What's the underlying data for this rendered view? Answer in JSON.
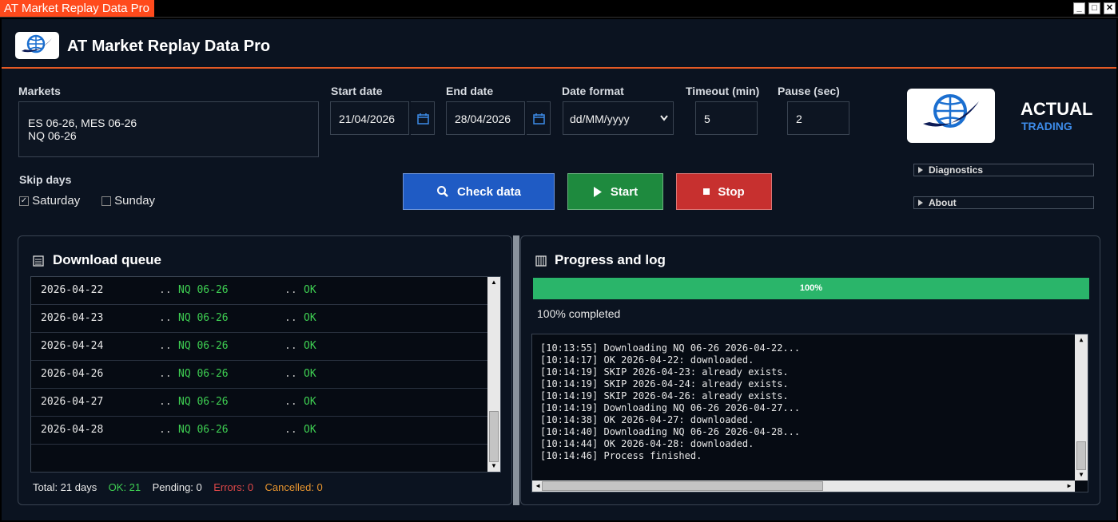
{
  "window": {
    "title": "AT Market Replay Data Pro",
    "controls": [
      "_",
      "□",
      "✕"
    ]
  },
  "header": {
    "title": "AT Market Replay Data Pro"
  },
  "form": {
    "markets_label": "Markets",
    "markets_value_line1": "ES 06-26, MES 06-26",
    "markets_value_line2": "NQ 06-26",
    "start_label": "Start date",
    "start_value": "21/04/2026",
    "end_label": "End date",
    "end_value": "28/04/2026",
    "format_label": "Date format",
    "format_value": "dd/MM/yyyy",
    "timeout_label": "Timeout (min)",
    "timeout_value": "5",
    "pause_label": "Pause (sec)",
    "pause_value": "2",
    "skip_label": "Skip days",
    "saturday_label": "Saturday",
    "saturday_checked": true,
    "sunday_label": "Sunday",
    "sunday_checked": false
  },
  "buttons": {
    "check": "Check data",
    "start": "Start",
    "stop": "Stop"
  },
  "colors": {
    "check": "#1f5bc4",
    "start": "#1e8a3e",
    "stop": "#c7302f",
    "accent": "#e55a25",
    "ok": "#3ecf52",
    "error": "#e04848",
    "cancel": "#e8952e",
    "progress": "#2ab56a"
  },
  "brand": {
    "line1": "ACTUAL",
    "line2": "TRADING"
  },
  "side": {
    "diagnostics": "Diagnostics",
    "about": "About"
  },
  "queue": {
    "title": "Download queue",
    "separator": "..",
    "rows": [
      {
        "date": "2026-04-22",
        "market": "NQ 06-26",
        "status": "OK"
      },
      {
        "date": "2026-04-23",
        "market": "NQ 06-26",
        "status": "OK"
      },
      {
        "date": "2026-04-24",
        "market": "NQ 06-26",
        "status": "OK"
      },
      {
        "date": "2026-04-26",
        "market": "NQ 06-26",
        "status": "OK"
      },
      {
        "date": "2026-04-27",
        "market": "NQ 06-26",
        "status": "OK"
      },
      {
        "date": "2026-04-28",
        "market": "NQ 06-26",
        "status": "OK"
      }
    ],
    "total": "Total: 21 days",
    "ok": "OK: 21",
    "pending": "Pending: 0",
    "errors": "Errors: 0",
    "cancelled": "Cancelled: 0"
  },
  "progress": {
    "title": "Progress and log",
    "percent": 100,
    "bar_label": "100%",
    "status": "100% completed",
    "log": [
      "[10:13:55] Downloading NQ 06-26 2026-04-22...",
      "[10:14:17] OK 2026-04-22: downloaded.",
      "[10:14:19] SKIP 2026-04-23: already exists.",
      "[10:14:19] SKIP 2026-04-24: already exists.",
      "[10:14:19] SKIP 2026-04-26: already exists.",
      "[10:14:19] Downloading NQ 06-26 2026-04-27...",
      "[10:14:38] OK 2026-04-27: downloaded.",
      "[10:14:40] Downloading NQ 06-26 2026-04-28...",
      "[10:14:44] OK 2026-04-28: downloaded.",
      "[10:14:46] Process finished."
    ]
  }
}
